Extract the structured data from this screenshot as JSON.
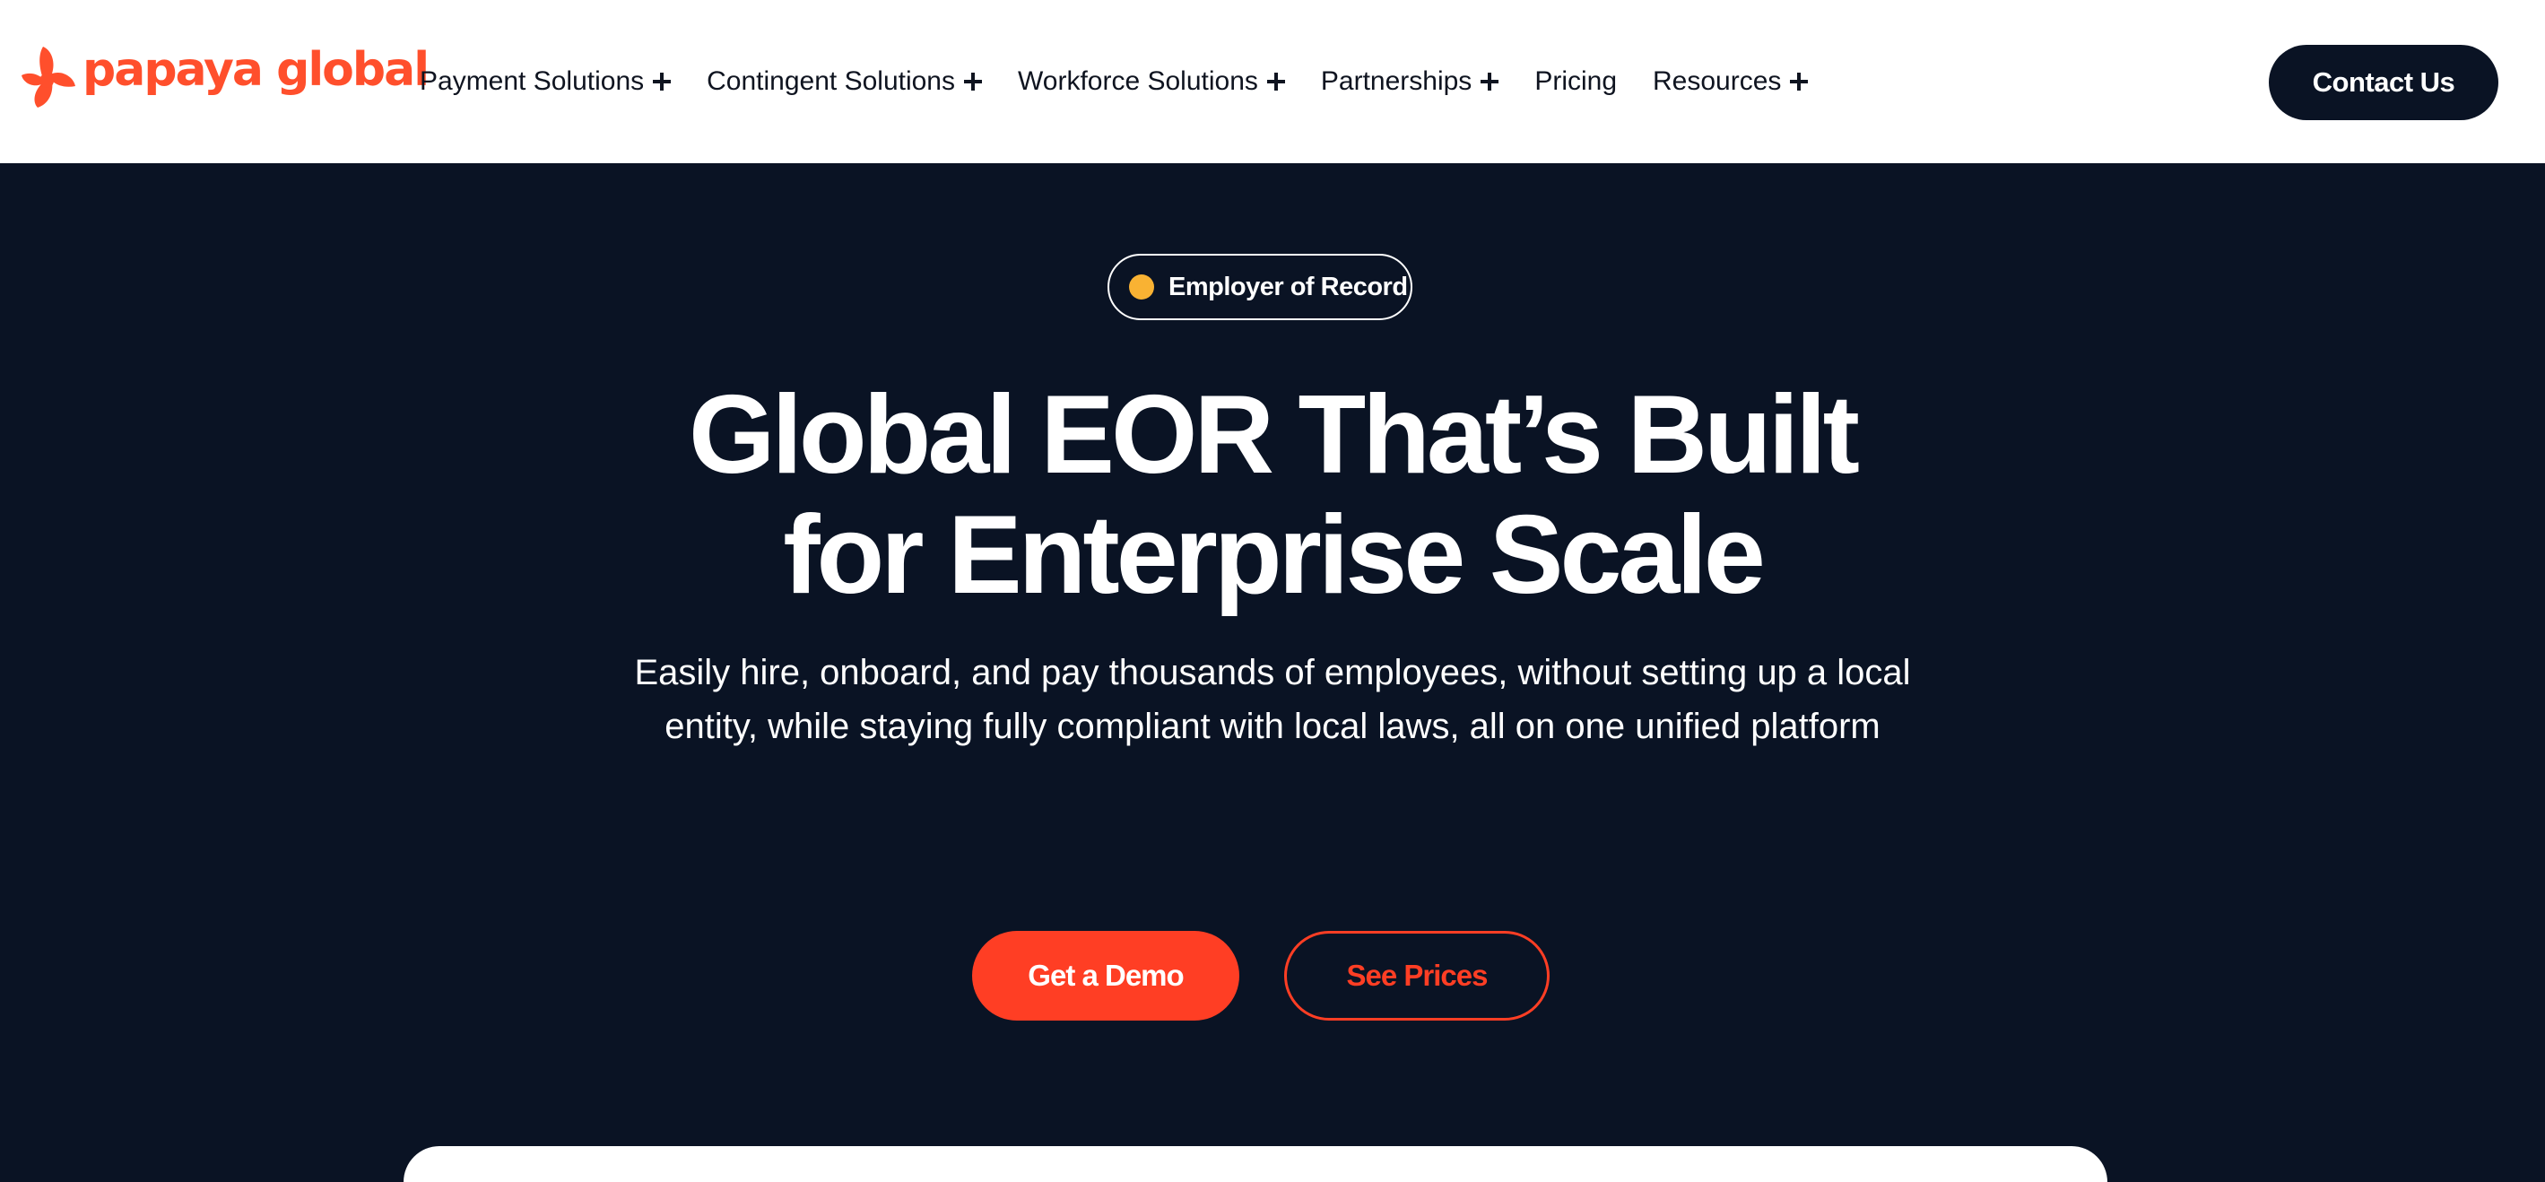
{
  "header": {
    "logo_text": "papaya global",
    "nav": [
      {
        "label": "Payment Solutions",
        "expandable": true
      },
      {
        "label": "Contingent Solutions",
        "expandable": true
      },
      {
        "label": "Workforce Solutions",
        "expandable": true
      },
      {
        "label": "Partnerships",
        "expandable": true
      },
      {
        "label": "Pricing",
        "expandable": false
      },
      {
        "label": "Resources",
        "expandable": true
      }
    ],
    "contact_label": "Contact Us"
  },
  "hero": {
    "badge": "Employer of Record",
    "headline_line1": "Global EOR That’s Built",
    "headline_line2": "for Enterprise Scale",
    "subtitle": "Easily hire, onboard, and pay thousands of employees, without setting up a local entity, while staying fully compliant with local laws, all on one unified platform",
    "primary_cta": "Get a Demo",
    "secondary_cta": "See Prices"
  },
  "colors": {
    "brand": "#ff4f2c",
    "cta": "#ff3e24",
    "background": "#0a1324",
    "badge_dot": "#f9b233"
  },
  "icons": {
    "logo": "papaya-flower-icon",
    "expand": "plus-icon"
  }
}
